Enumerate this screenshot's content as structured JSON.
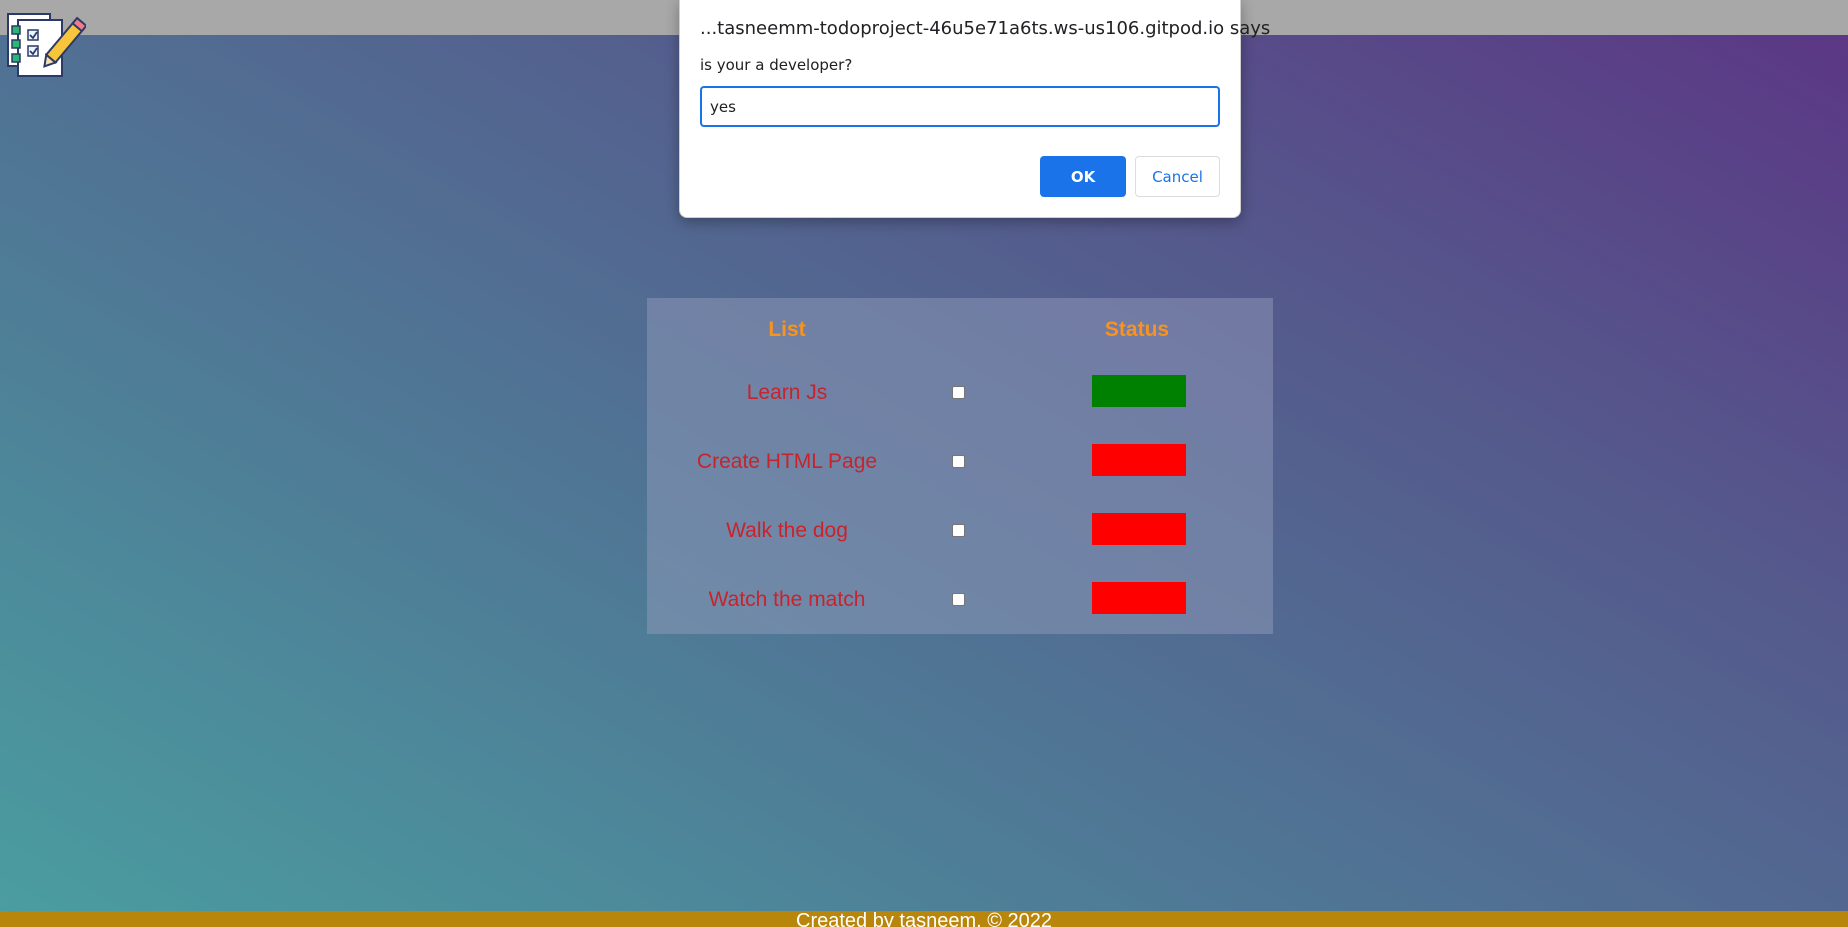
{
  "dialog": {
    "title": "...tasneemm-todoproject-46u5e71a6ts.ws-us106.gitpod.io says",
    "message": "is your a developer?",
    "input_value": "yes",
    "ok_label": "OK",
    "cancel_label": "Cancel"
  },
  "table": {
    "headers": {
      "list": "List",
      "status": "Status"
    },
    "rows": [
      {
        "task": "Learn Js",
        "checked": false,
        "status_color": "#008000"
      },
      {
        "task": "Create HTML Page",
        "checked": false,
        "status_color": "#ff0000"
      },
      {
        "task": "Walk the dog",
        "checked": false,
        "status_color": "#ff0000"
      },
      {
        "task": "Watch the match",
        "checked": false,
        "status_color": "#ff0000"
      }
    ]
  },
  "footer": {
    "text": "Created by tasneem. © 2022"
  },
  "colors": {
    "header_text": "#f7931e",
    "task_text": "#c8232c",
    "footer_bg": "#b8860b",
    "accent": "#1a73e8"
  },
  "icons": {
    "logo": "checklist-pencil-icon"
  }
}
